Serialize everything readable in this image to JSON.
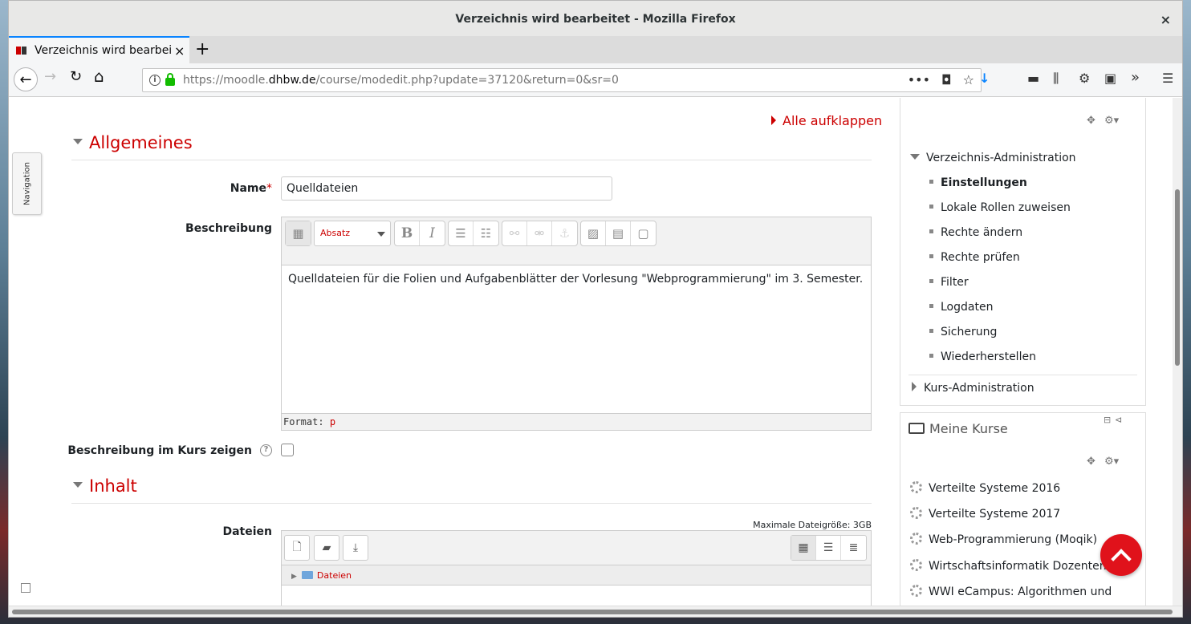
{
  "window": {
    "title": "Verzeichnis wird bearbeitet - Mozilla Firefox",
    "close": "×"
  },
  "tab": {
    "title": "Verzeichnis wird bearbeitet",
    "close": "×",
    "new_tab": "+"
  },
  "nav": {
    "back": "←",
    "forward": "→",
    "reload": "↻",
    "home": "⌂",
    "url_prefix": "https://moodle.",
    "url_domain": "dhbw.de",
    "url_rest": "/course/modedit.php?update=37120&return=0&sr=0",
    "url_menu": "•••",
    "download": "↓",
    "overflow": "»",
    "menu": "☰"
  },
  "page": {
    "expand_all": "Alle aufklappen",
    "nav_drawer": "Navigation",
    "section_general": "Allgemeines",
    "name_label": "Name",
    "required_mark": "*",
    "name_value": "Quelldateien",
    "description_label": "Beschreibung",
    "editor_paragraph_select": "Absatz",
    "editor_text": "Quelldateien für die Folien und Aufgabenblätter der Vorlesung \"Webprogrammierung\" im 3. Semester.",
    "editor_format_label": "Format:",
    "editor_format_value": "p",
    "show_description_label": "Beschreibung im Kurs zeigen",
    "help_icon": "?",
    "section_content": "Inhalt",
    "files_label": "Dateien",
    "max_file_size": "Maximale Dateigröße: 3GB",
    "files_folder": "Dateien"
  },
  "admin_block": {
    "heading": "Verzeichnis-Administration",
    "items": [
      "Einstellungen",
      "Lokale Rollen zuweisen",
      "Rechte ändern",
      "Rechte prüfen",
      "Filter",
      "Logdaten",
      "Sicherung",
      "Wiederherstellen"
    ],
    "active_item": "Einstellungen",
    "course_admin": "Kurs-Administration"
  },
  "courses_block": {
    "title": "Meine Kurse",
    "courses": [
      "Verteilte Systeme 2016",
      "Verteilte Systeme 2017",
      "Web-Programmierung (Moqik)",
      "Wirtschaftsinformatik Dozenten",
      "WWI eCampus: Algorithmen und"
    ]
  },
  "colors": {
    "accent": "#cc0000",
    "fab": "#e0121b",
    "firefox_blue": "#0a84ff"
  }
}
